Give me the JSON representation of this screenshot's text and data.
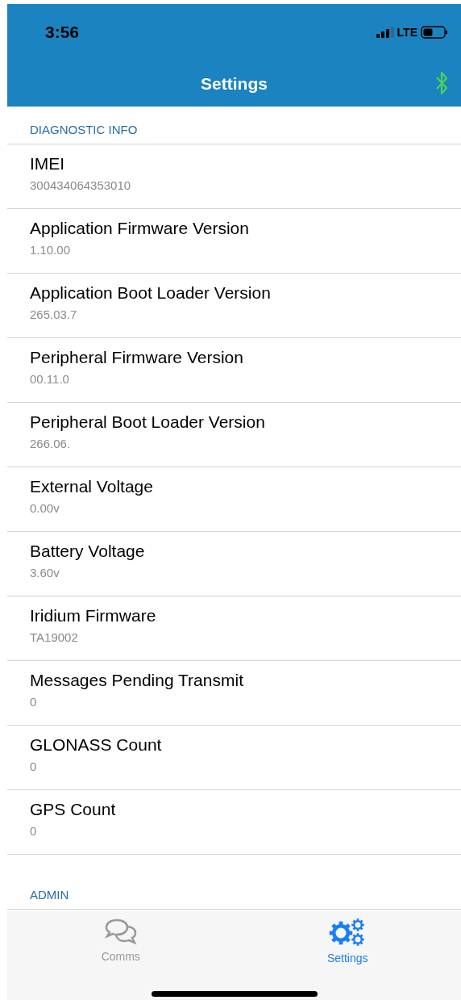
{
  "status_bar": {
    "time": "3:56",
    "network": "LTE"
  },
  "nav_bar": {
    "title": "Settings",
    "bluetooth_connected": true
  },
  "sections": [
    {
      "header": "DIAGNOSTIC INFO",
      "rows": [
        {
          "title": "IMEI",
          "value": "300434064353010"
        },
        {
          "title": "Application Firmware Version",
          "value": "1.10.00"
        },
        {
          "title": "Application Boot Loader Version",
          "value": "265.03.7"
        },
        {
          "title": "Peripheral Firmware Version",
          "value": "00.11.0"
        },
        {
          "title": "Peripheral Boot Loader Version",
          "value": "266.06."
        },
        {
          "title": "External Voltage",
          "value": "0.00v"
        },
        {
          "title": "Battery Voltage",
          "value": "3.60v"
        },
        {
          "title": "Iridium Firmware",
          "value": "TA19002"
        },
        {
          "title": "Messages Pending Transmit",
          "value": "0"
        },
        {
          "title": "GLONASS Count",
          "value": "0"
        },
        {
          "title": "GPS Count",
          "value": "0"
        }
      ]
    },
    {
      "header": "ADMIN"
    }
  ],
  "tab_bar": [
    {
      "label": "Comms",
      "kind": "chat",
      "selected": false
    },
    {
      "label": "Settings",
      "kind": "gears",
      "selected": true
    }
  ]
}
